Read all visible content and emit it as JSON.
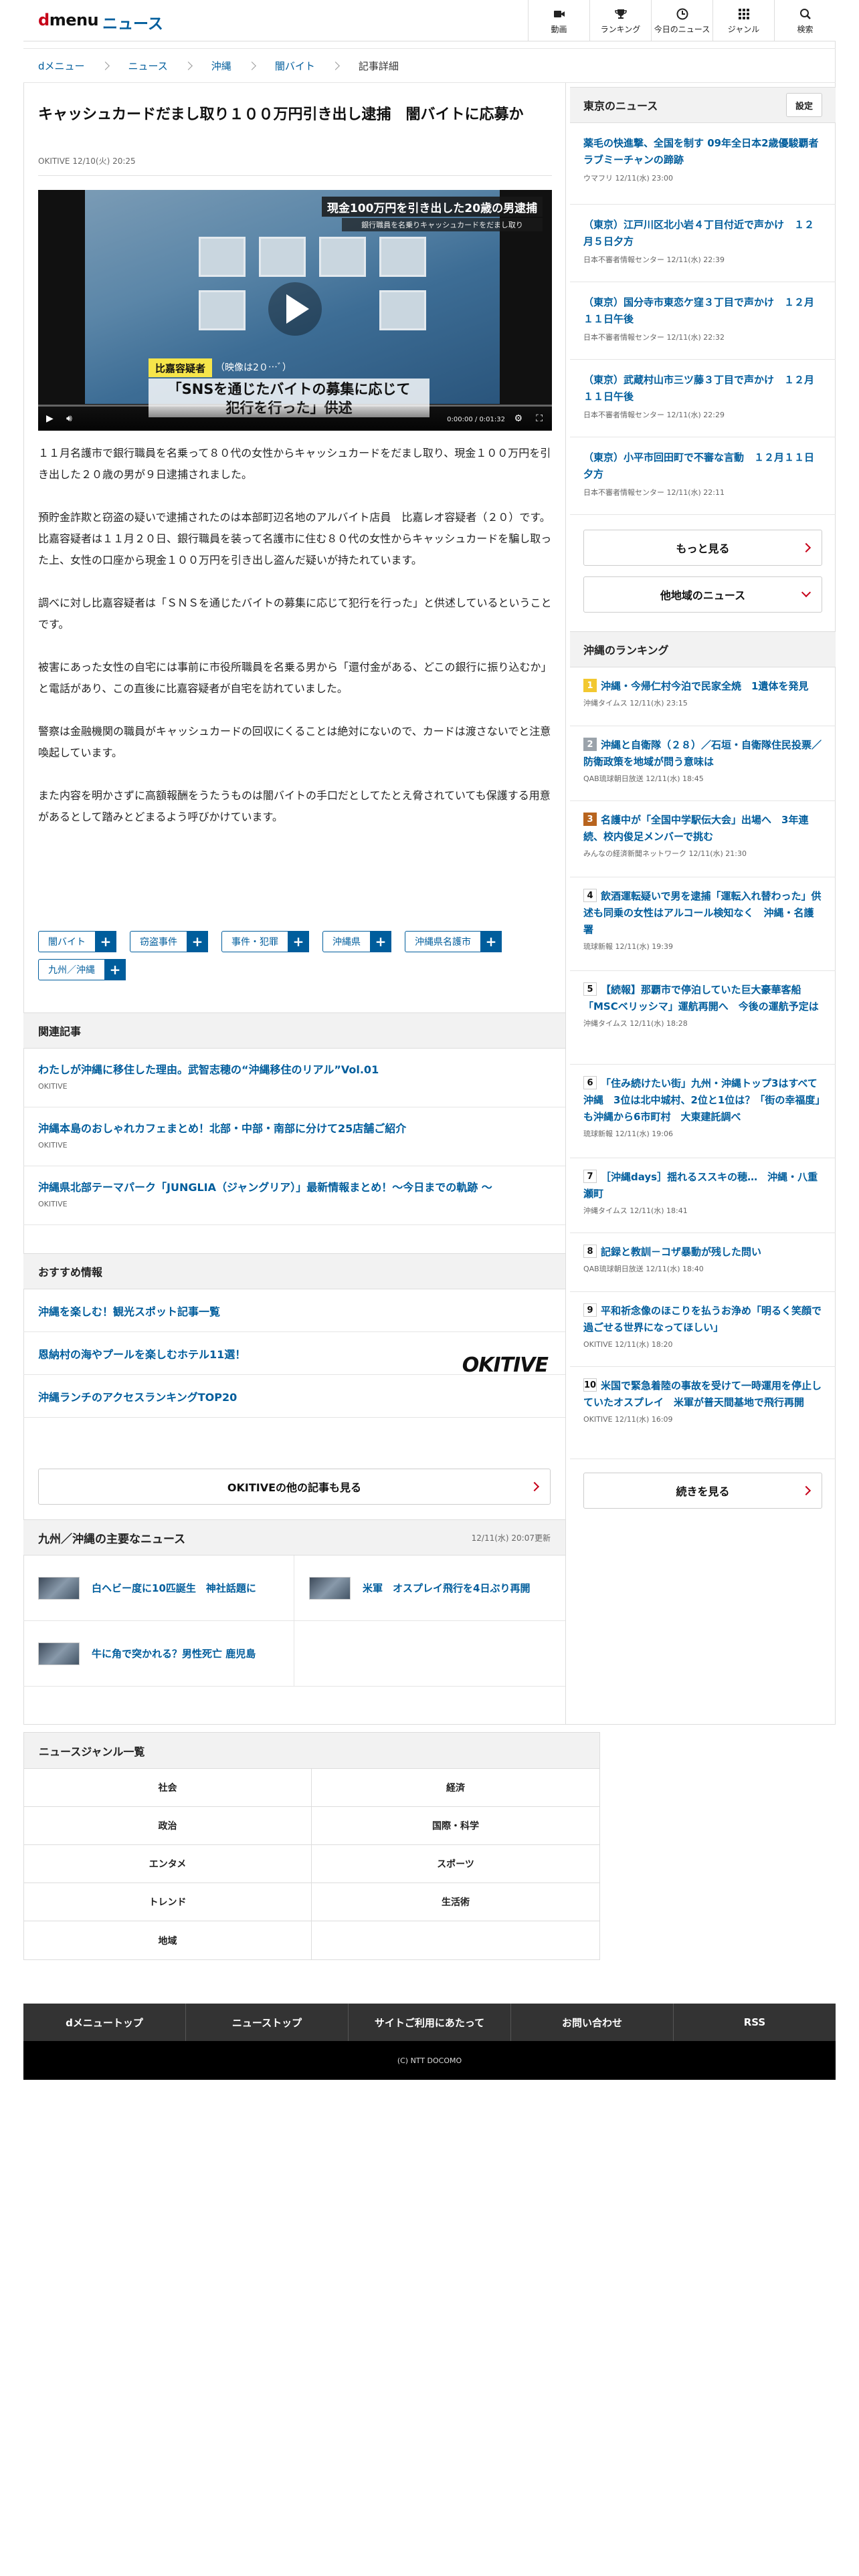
{
  "header": {
    "logo_d": "d",
    "logo_menu": "menu",
    "logo_sub": "ニュース",
    "nav": [
      {
        "label": "動画",
        "icon": "video-camera-icon"
      },
      {
        "label": "ランキング",
        "icon": "trophy-icon"
      },
      {
        "label": "今日のニュース",
        "icon": "clock-icon"
      },
      {
        "label": "ジャンル",
        "icon": "grid-icon"
      },
      {
        "label": "検索",
        "icon": "search-icon"
      }
    ]
  },
  "breadcrumb": [
    "dメニュー",
    "ニュース",
    "沖縄",
    "闇バイト",
    "記事詳細"
  ],
  "article": {
    "title": "キャッシュカードだまし取り１００万円引き出し逮捕　闇バイトに応募か",
    "meta": "OKITIVE 12/10(火) 20:25",
    "video": {
      "banner": "現金100万円を引き出した20歳の男逮捕",
      "subbanner": "銀行職員を名乗りキャッシュカードをだまし取り",
      "tag": "比嘉容疑者",
      "tag2": "（映像は2０…ﾞ）",
      "caption_line1": "「SNSを通じたバイトの募集に応じて",
      "caption_line2": "犯行を行った」供述",
      "time": "0:00:00 / 0:01:32"
    },
    "paragraphs": [
      "１１月名護市で銀行職員を名乗って８０代の女性からキャッシュカードをだまし取り、現金１００万円を引き出した２０歳の男が９日逮捕されました。",
      "預貯金詐欺と窃盗の疑いで逮捕されたのは本部町辺名地のアルバイト店員　比嘉レオ容疑者（２０）です。比嘉容疑者は１１月２０日、銀行職員を装って名護市に住む８０代の女性からキャッシュカードを騙し取った上、女性の口座から現金１００万円を引き出し盗んだ疑いが持たれています。",
      "調べに対し比嘉容疑者は「ＳＮＳを通じたバイトの募集に応じて犯行を行った」と供述しているということです。",
      "被害にあった女性の自宅には事前に市役所職員を名乗る男から「還付金がある、どこの銀行に振り込むか」と電話があり、この直後に比嘉容疑者が自宅を訪れていました。",
      "警察は金融機関の職員がキャッシュカードの回収にくることは絶対にないので、カードは渡さないでと注意喚起しています。",
      "また内容を明かさずに高額報酬をうたうものは闇バイトの手口だとしてたとえ脅されていても保護する用意があるとして踏みとどまるよう呼びかけています。"
    ],
    "tags": [
      "闇バイト",
      "窃盗事件",
      "事件・犯罪",
      "沖縄県",
      "沖縄県名護市",
      "九州／沖縄"
    ],
    "tag_plus": "+"
  },
  "related": {
    "heading": "関連記事",
    "items": [
      {
        "title": "わたしが沖縄に移住した理由。武智志穂の“沖縄移住のリアル”Vol.01",
        "source": "OKITIVE"
      },
      {
        "title": "沖縄本島のおしゃれカフェまとめ！北部・中部・南部に分けて25店舗ご紹介",
        "source": "OKITIVE"
      },
      {
        "title": "沖縄県北部テーマパーク「JUNGLIA（ジャングリア）」最新情報まとめ！～今日までの軌跡 ～",
        "source": "OKITIVE"
      }
    ]
  },
  "recommend": {
    "heading": "おすすめ情報",
    "items": [
      "沖縄を楽しむ！観光スポット記事一覧",
      "恩納村の海やプールを楽しむホテル11選！",
      "沖縄ランチのアクセスランキングTOP20"
    ],
    "provider_logo": "OKITIVE",
    "more_label": "OKITIVEの他の記事も見る"
  },
  "regional": {
    "heading": "九州／沖縄の主要なニュース",
    "updated": "12/11(水) 20:07更新",
    "items": [
      "白ヘビー度に10匹誕生　神社話題に",
      "米軍　オスプレイ飛行を4日ぶり再開",
      "牛に角で突かれる？男性死亡 鹿児島"
    ]
  },
  "sidebar": {
    "tokyo": {
      "heading": "東京のニュース",
      "setting_label": "設定",
      "items": [
        {
          "title": "薬毛の快進撃、全国を制す 09年全日本2歳優駿覇者ラブミーチャンの蹄跡",
          "source": "ウマフリ 12/11(水) 23:00"
        },
        {
          "title": "（東京）江戸川区北小岩４丁目付近で声かけ　１２月５日夕方",
          "source": "日本不審者情報センター 12/11(水) 22:39"
        },
        {
          "title": "（東京）国分寺市東恋ケ窪３丁目で声かけ　１２月１１日午後",
          "source": "日本不審者情報センター 12/11(水) 22:32"
        },
        {
          "title": "（東京）武蔵村山市三ツ藤３丁目で声かけ　１２月１１日午後",
          "source": "日本不審者情報センター 12/11(水) 22:29"
        },
        {
          "title": "（東京）小平市回田町で不審な言動　１２月１１日夕方",
          "source": "日本不審者情報センター 12/11(水) 22:11"
        }
      ],
      "more_label": "もっと見る",
      "other_label": "他地域のニュース"
    },
    "ranking": {
      "heading": "沖縄のランキング",
      "items": [
        {
          "rank": "1",
          "title": "沖縄・今帰仁村今泊で民家全焼　1遺体を発見",
          "source": "沖縄タイムス 12/11(水) 23:15"
        },
        {
          "rank": "2",
          "title": "沖縄と自衛隊（２８）／石垣・自衛隊住民投票／防衛政策を地域が問う意味は",
          "source": "QAB琉球朝日放送 12/11(水) 18:45"
        },
        {
          "rank": "3",
          "title": "名護中が「全国中学駅伝大会」出場へ　3年連続、校内俊足メンバーで挑む",
          "source": "みんなの経済新聞ネットワーク 12/11(水) 21:30"
        },
        {
          "rank": "4",
          "title": "飲酒運転疑いで男を逮捕「運転入れ替わった」供述も同乗の女性はアルコール検知なく　沖縄・名護署",
          "source": "琉球新報 12/11(水) 19:39"
        },
        {
          "rank": "5",
          "title": "【続報】那覇市で停泊していた巨大豪華客船「MSCベリッシマ」運航再開へ　今後の運航予定は",
          "source": "沖縄タイムス 12/11(水) 18:28"
        },
        {
          "rank": "6",
          "title": "「住み続けたい街」九州・沖縄トップ3はすべて沖縄　3位は北中城村、2位と1位は？「街の幸福度」も沖縄から6市町村　大東建託調べ",
          "source": "琉球新報 12/11(水) 19:06"
        },
        {
          "rank": "7",
          "title": "［沖縄days］揺れるススキの穂…　沖縄・八重瀬町",
          "source": "沖縄タイムス 12/11(水) 18:41"
        },
        {
          "rank": "8",
          "title": "記録と教訓－コザ暴動が残した問い",
          "source": "QAB琉球朝日放送 12/11(水) 18:40"
        },
        {
          "rank": "9",
          "title": "平和祈念像のほこりを払うお浄め「明るく笑顔で過ごせる世界になってほしい」",
          "source": "OKITIVE 12/11(水) 18:20"
        },
        {
          "rank": "10",
          "title": "米国で緊急着陸の事故を受けて一時運用を停止していたオスプレイ　米軍が普天間基地で飛行再開",
          "source": "OKITIVE 12/11(水) 16:09"
        }
      ],
      "more_label": "続きを見る"
    }
  },
  "genres": {
    "heading": "ニュースジャンル一覧",
    "items": [
      "社会",
      "経済",
      "政治",
      "国際・科学",
      "エンタメ",
      "スポーツ",
      "トレンド",
      "生活術",
      "地域",
      ""
    ]
  },
  "footer": {
    "links": [
      "dメニュートップ",
      "ニューストップ",
      "サイトご利用にあたって",
      "お問い合わせ",
      "RSS"
    ],
    "copyright": "(C) NTT DOCOMO"
  }
}
